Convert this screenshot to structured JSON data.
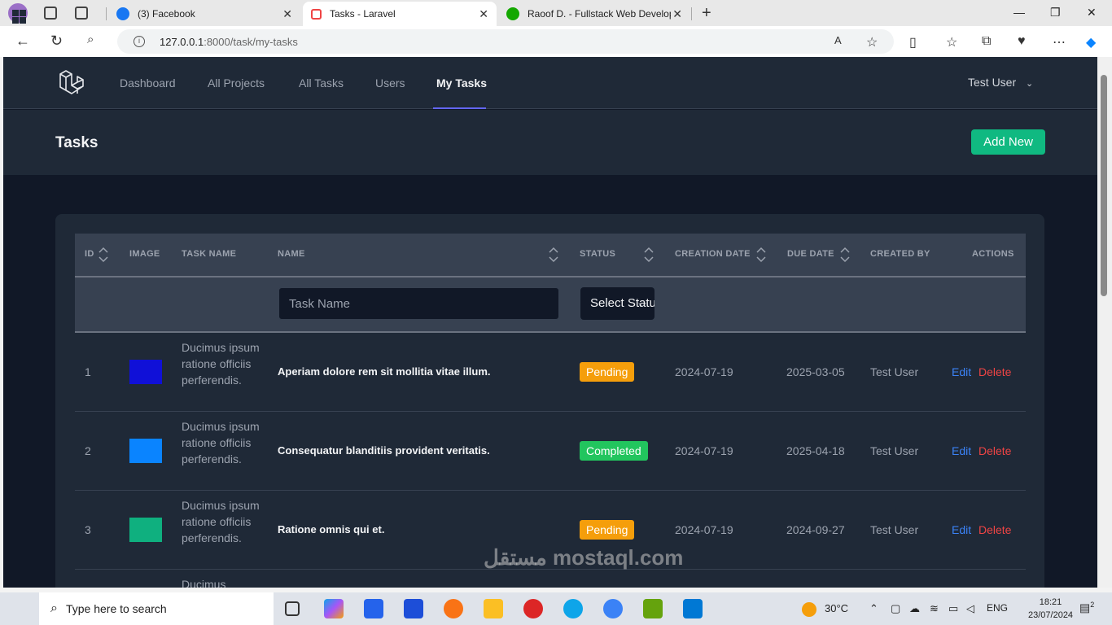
{
  "browser": {
    "tabs": [
      {
        "title": "(3) Facebook"
      },
      {
        "title": "Tasks - Laravel"
      },
      {
        "title": "Raoof D. - Fullstack Web Develop"
      }
    ],
    "url_host": "127.0.0.1",
    "url_rest": ":8000/task/my-tasks"
  },
  "nav": {
    "links": [
      "Dashboard",
      "All Projects",
      "All Tasks",
      "Users",
      "My Tasks"
    ],
    "active": "My Tasks",
    "user": "Test User"
  },
  "header": {
    "title": "Tasks",
    "add_new": "Add New"
  },
  "table": {
    "columns": {
      "id": "ID",
      "image": "IMAGE",
      "task_name": "TASK NAME",
      "name": "NAME",
      "status": "STATUS",
      "creation_date": "CREATION DATE",
      "due_date": "DUE DATE",
      "created_by": "CREATED BY",
      "actions": "ACTIONS"
    },
    "filter": {
      "task_name_placeholder": "Task Name",
      "status_select": "Select Status"
    },
    "rows": [
      {
        "id": "1",
        "image_color": "#1010d8",
        "task_name": "Ducimus ipsum ratione officiis perferendis.",
        "name": "Aperiam dolore rem sit mollitia vitae illum.",
        "status": "Pending",
        "status_color": "#f59e0b",
        "created": "2024-07-19",
        "due": "2025-03-05",
        "created_by": "Test User",
        "edit": "Edit",
        "delete": "Delete"
      },
      {
        "id": "2",
        "image_color": "#0a84ff",
        "task_name": "Ducimus ipsum ratione officiis perferendis.",
        "name": "Consequatur blanditiis provident veritatis.",
        "status": "Completed",
        "status_color": "#22c55e",
        "created": "2024-07-19",
        "due": "2025-04-18",
        "created_by": "Test User",
        "edit": "Edit",
        "delete": "Delete"
      },
      {
        "id": "3",
        "image_color": "#0fb07f",
        "task_name": "Ducimus ipsum ratione officiis perferendis.",
        "name": "Ratione omnis qui et.",
        "status": "Pending",
        "status_color": "#f59e0b",
        "created": "2024-07-19",
        "due": "2024-09-27",
        "created_by": "Test User",
        "edit": "Edit",
        "delete": "Delete"
      },
      {
        "id": "",
        "image_color": "",
        "task_name": "Ducimus",
        "name": "",
        "status": "",
        "status_color": "",
        "created": "",
        "due": "",
        "created_by": "",
        "edit": "",
        "delete": ""
      }
    ]
  },
  "taskbar": {
    "search_placeholder": "Type here to search",
    "weather": "30°C",
    "lang": "ENG",
    "time": "18:21",
    "date": "23/07/2024",
    "notifications": "2"
  },
  "watermark": "مستقل mostaql.com"
}
